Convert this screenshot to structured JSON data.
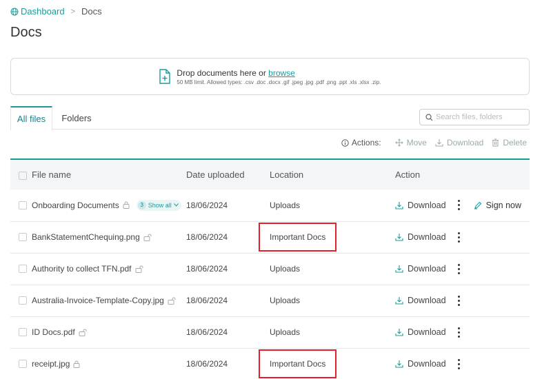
{
  "breadcrumb": {
    "home": "Dashboard",
    "separator": ">",
    "current": "Docs"
  },
  "page_title": "Docs",
  "dropzone": {
    "prompt": "Drop documents here or",
    "browse": "browse",
    "limits": "50 MB limit. Allowed types: .csv .doc .docx .gif .jpeg .jpg .pdf .png .ppt .xls .xlsx .zip."
  },
  "tabs": [
    {
      "label": "All files",
      "active": true
    },
    {
      "label": "Folders",
      "active": false
    }
  ],
  "search": {
    "placeholder": "Search files, folders",
    "value": ""
  },
  "actions": {
    "label": "Actions:",
    "move": "Move",
    "download": "Download",
    "delete": "Delete"
  },
  "table": {
    "headers": {
      "name": "File name",
      "date": "Date uploaded",
      "location": "Location",
      "action": "Action"
    },
    "rows": [
      {
        "name": "Onboarding Documents",
        "show_all_count": "3",
        "show_all_label": "Show all",
        "date": "18/06/2024",
        "location": "Uploads",
        "download": "Download",
        "sign": "Sign now",
        "highlight": false
      },
      {
        "name": "BankStatementChequing.png",
        "date": "18/06/2024",
        "location": "Important Docs",
        "download": "Download",
        "highlight": true
      },
      {
        "name": "Authority to collect TFN.pdf",
        "date": "18/06/2024",
        "location": "Uploads",
        "download": "Download",
        "highlight": false
      },
      {
        "name": "Australia-Invoice-Template-Copy.jpg",
        "date": "18/06/2024",
        "location": "Uploads",
        "download": "Download",
        "highlight": false
      },
      {
        "name": "ID Docs.pdf",
        "date": "18/06/2024",
        "location": "Uploads",
        "download": "Download",
        "highlight": false
      },
      {
        "name": "receipt.jpg",
        "date": "18/06/2024",
        "location": "Important Docs",
        "download": "Download",
        "highlight": true
      }
    ]
  },
  "colors": {
    "accent": "#1a9b9b",
    "highlight": "#e0202a"
  }
}
